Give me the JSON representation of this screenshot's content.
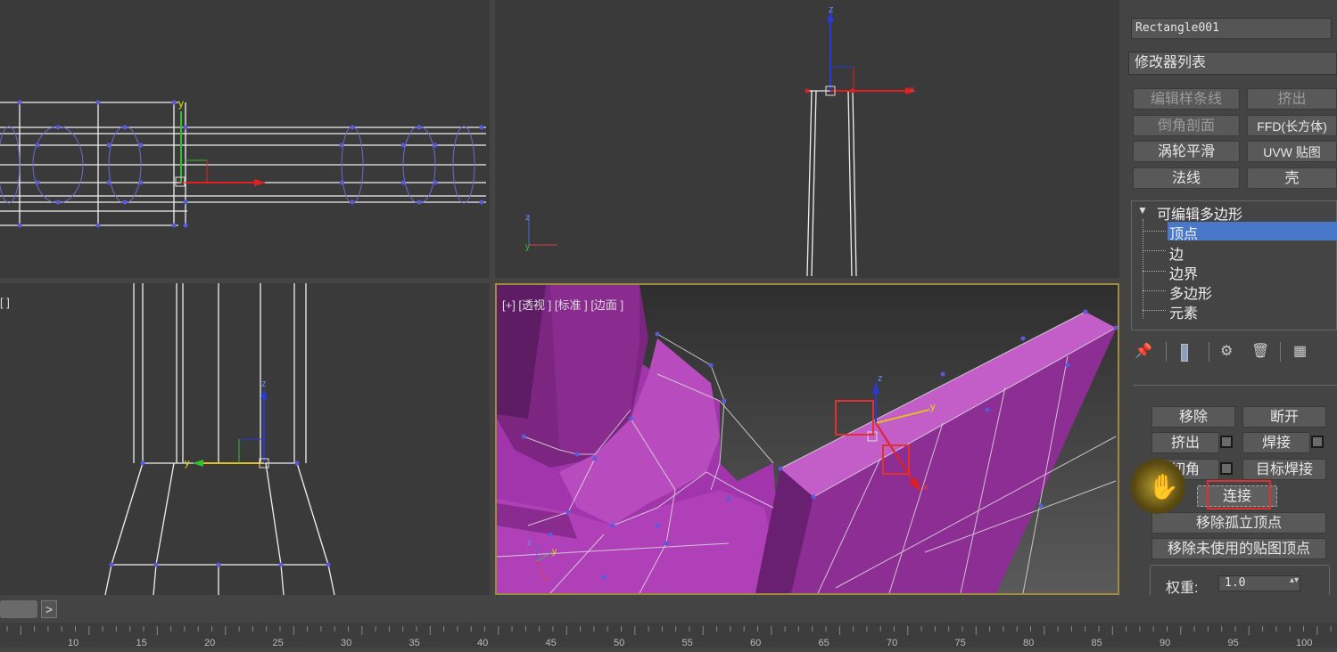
{
  "viewports": {
    "left_label": "[ ]",
    "persp_label": "[+] [透视 ] [标准 ] [边面 ]",
    "axes": {
      "x": "x",
      "y": "y",
      "z": "z"
    }
  },
  "panel": {
    "object_name": "Rectangle001",
    "modifier_list": "修改器列表",
    "modifier_buttons": [
      {
        "label": "编辑样条线",
        "dim": true
      },
      {
        "label": "挤出",
        "dim": true
      },
      {
        "label": "倒角剖面",
        "dim": true
      },
      {
        "label": "FFD(长方体)",
        "dim": false
      },
      {
        "label": "涡轮平滑",
        "dim": false
      },
      {
        "label": "UVW 贴图",
        "dim": false
      },
      {
        "label": "法线",
        "dim": false
      },
      {
        "label": "壳",
        "dim": false
      }
    ],
    "stack": {
      "root": "可编辑多边形",
      "items": [
        "顶点",
        "边",
        "边界",
        "多边形",
        "元素"
      ],
      "selected_index": 0
    },
    "edit_vertices": {
      "remove": "移除",
      "break": "断开",
      "extrude": "挤出",
      "weld": "焊接",
      "chamfer": "切角",
      "target_weld": "目标焊接",
      "connect": "连接",
      "remove_isolated": "移除孤立顶点",
      "remove_unused_map": "移除未使用的贴图顶点",
      "weight_label": "权重:",
      "weight_value": "1.0"
    }
  },
  "timeline": {
    "ticks": [
      "10",
      "15",
      "20",
      "25",
      "30",
      "35",
      "40",
      "45",
      "50",
      "55",
      "60",
      "65",
      "70",
      "75",
      "80",
      "85",
      "90",
      "95",
      "100"
    ],
    "arrow": ">"
  },
  "colors": {
    "viewport_bg": "#3a3a3a",
    "magenta": "#b03cb8",
    "highlight": "#e03030",
    "selected": "#4a78c8"
  }
}
